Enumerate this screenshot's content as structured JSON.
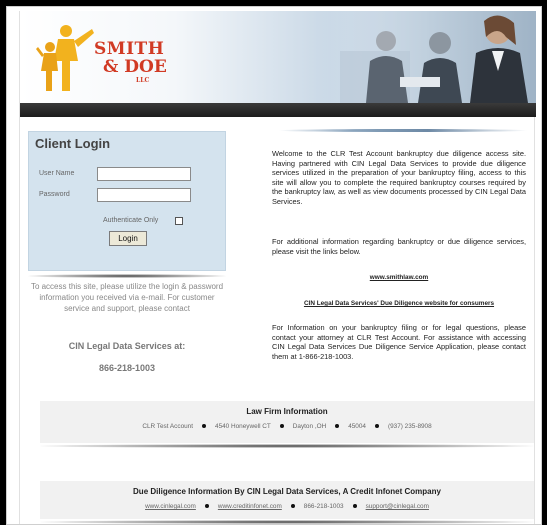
{
  "brand": {
    "line1": "SMITH",
    "line2": "& DOE",
    "line3": "LLC"
  },
  "login": {
    "title": "Client Login",
    "username_label": "User Name",
    "username_value": "",
    "password_label": "Password",
    "password_value": "",
    "authenticate_label": "Authenticate Only",
    "button_label": "Login"
  },
  "left_info": {
    "instructions": "To access this site, please utilize the login & password information you received via e-mail. For customer service and support, please contact",
    "cin_at": "CIN Legal Data Services at:",
    "phone": "866-218-1003"
  },
  "main": {
    "welcome": "Welcome to the CLR Test Account bankruptcy due diligence access site. Having partnered with CIN Legal Data Services to provide due diligence services utilized in the preparation of your bankruptcy filing, access to this site will allow you to complete the required bankruptcy courses required by the bankruptcy law, as well as view documents processed by CIN Legal Data Services.",
    "additional": "For additional information regarding bankruptcy or due diligence services, please visit the links below.",
    "link1": "www.smithlaw.com",
    "link2": "CIN Legal Data Services' Due Diligence website for consumers",
    "info": "For Information on your bankruptcy filing or for legal questions, please contact your attorney at CLR Test Account. For assistance with accessing CIN Legal Data Services Due Diligence Service Application, please contact them at 1-866-218-1003."
  },
  "law_firm": {
    "title": "Law Firm Information",
    "name": "CLR Test Account",
    "address": "4540 Honeywell CT",
    "city_state": "Dayton ,OH",
    "zip": "45004",
    "phone": "(937) 235-8908"
  },
  "due_diligence": {
    "title": "Due Diligence Information By CIN Legal Data Services, A Credit Infonet Company",
    "site1": "www.cinlegal.com",
    "site2": "www.creditinfonet.com",
    "phone": "866-218-1003",
    "email": "support@cinlegal.com"
  },
  "colors": {
    "brand_red": "#d13a24",
    "login_panel": "#d4e3ee",
    "dark_bar": "#222222"
  }
}
